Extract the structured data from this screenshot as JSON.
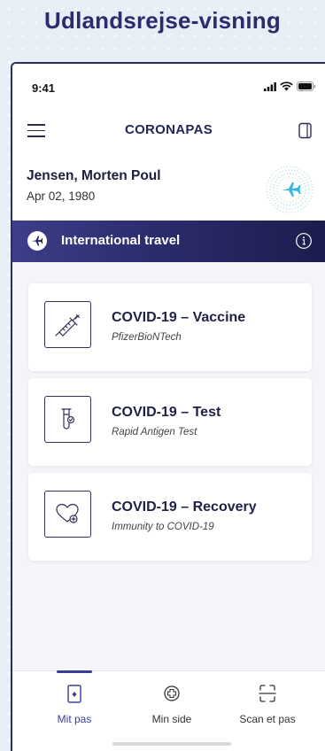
{
  "caption": "Udlandsrejse-visning",
  "status_bar": {
    "time": "9:41"
  },
  "header": {
    "title": "CORONAPAS"
  },
  "person": {
    "name": "Jensen, Morten Poul",
    "dob": "Apr 02, 1980"
  },
  "banner": {
    "title": "International travel"
  },
  "certificates": [
    {
      "title": "COVID-19 – Vaccine",
      "subtitle": "PfizerBioNTech",
      "icon": "syringe-icon"
    },
    {
      "title": "COVID-19 – Test",
      "subtitle": "Rapid Antigen Test",
      "icon": "test-tube-icon"
    },
    {
      "title": "COVID-19 – Recovery",
      "subtitle": "Immunity to COVID-19",
      "icon": "heart-plus-icon"
    }
  ],
  "tabs": [
    {
      "label": "Mit pas",
      "icon": "passport-icon",
      "active": true
    },
    {
      "label": "Min side",
      "icon": "plus-circle-icon",
      "active": false
    },
    {
      "label": "Scan et pas",
      "icon": "scan-icon",
      "active": false
    }
  ],
  "colors": {
    "primary": "#2a2c6e",
    "accent": "#3b3d99",
    "background": "#f4f5f8"
  }
}
